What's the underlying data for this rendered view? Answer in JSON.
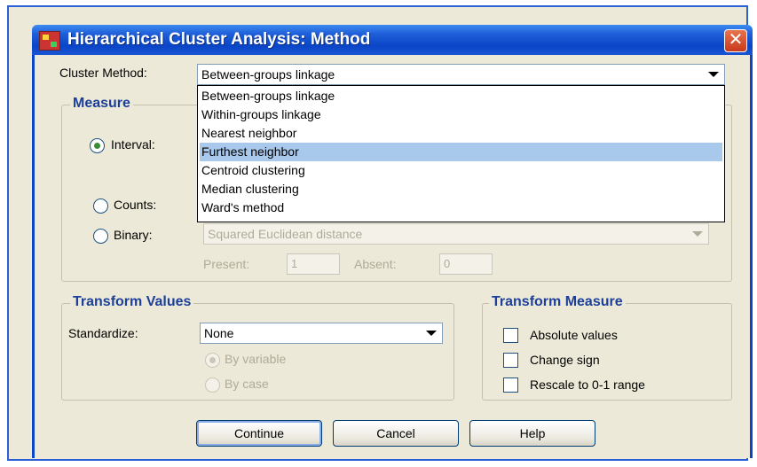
{
  "window": {
    "title": "Hierarchical Cluster Analysis: Method",
    "close_glyph": "✕"
  },
  "cluster_method": {
    "label": "Cluster Method:",
    "value": "Between-groups linkage",
    "options": [
      "Between-groups linkage",
      "Within-groups linkage",
      "Nearest neighbor",
      "Furthest neighbor",
      "Centroid clustering",
      "Median clustering",
      "Ward's method"
    ],
    "highlighted": "Furthest neighbor"
  },
  "measure": {
    "title": "Measure",
    "interval_label": "Interval:",
    "counts_label": "Counts:",
    "binary_label": "Binary:",
    "binary_value": "Squared Euclidean distance",
    "present_label": "Present:",
    "present_value": "1",
    "absent_label": "Absent:",
    "absent_value": "0"
  },
  "transform_values": {
    "title": "Transform Values",
    "standardize_label": "Standardize:",
    "standardize_value": "None",
    "by_variable_label": "By variable",
    "by_case_label": "By case"
  },
  "transform_measure": {
    "title": "Transform Measure",
    "absolute_label": "Absolute values",
    "change_sign_label": "Change sign",
    "rescale_label": "Rescale to 0-1 range"
  },
  "buttons": {
    "continue": "Continue",
    "cancel": "Cancel",
    "help": "Help"
  }
}
